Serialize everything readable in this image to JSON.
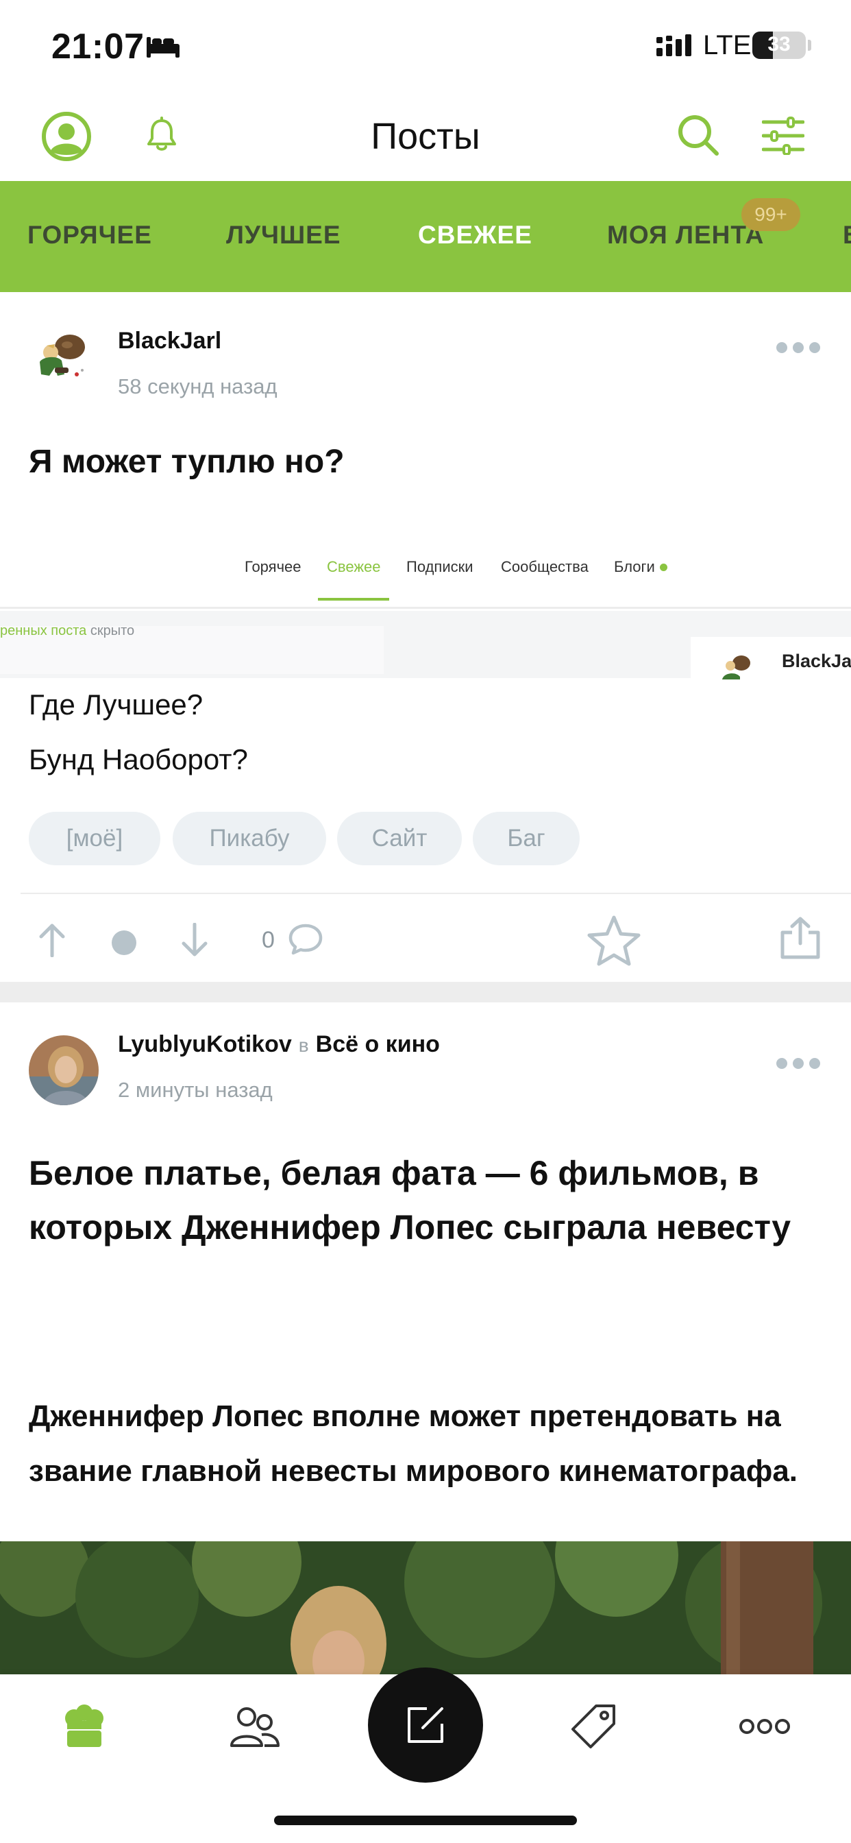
{
  "status_bar": {
    "time": "21:07",
    "network": "LTE",
    "battery": "33"
  },
  "header": {
    "title": "Посты"
  },
  "tabs": {
    "items": [
      "ГОРЯЧЕЕ",
      "ЛУЧШЕЕ",
      "СВЕЖЕЕ",
      "МОЯ ЛЕНТА"
    ],
    "active": "СВЕЖЕЕ",
    "badge": "99+"
  },
  "post1": {
    "author": "BlackJarl",
    "time": "58 секунд назад",
    "title": "Я может туплю но?",
    "screenshot": {
      "tabs": [
        "Горячее",
        "Свежее",
        "Подписки",
        "Сообщества",
        "Блоги"
      ],
      "active_tab": "Свежее",
      "hidden_text_green": "ренных поста",
      "hidden_text": "скрыто",
      "card_author": "BlackJa"
    },
    "body_lines": [
      "Где Лучшее?",
      "Бунд Наоборот?"
    ],
    "tags": [
      "[моё]",
      "Пикабу",
      "Сайт",
      "Баг"
    ],
    "comments": "0"
  },
  "post2": {
    "author": "LyublyuKotikov",
    "in_word": "в",
    "community": "Всё о кино",
    "time": "2 минуты назад",
    "title": "Белое платье, белая фата — 6 фильмов, в которых Дженнифер Лопес сыграла невесту",
    "lead": "Дженнифер Лопес вполне может претендовать на звание главной невесты мирового кинематографа."
  },
  "colors": {
    "brand_green": "#8ac440",
    "badge": "#b79d3c",
    "muted": "#9aa3a8"
  },
  "tabbar": {
    "icons": [
      "home-icon",
      "communities-icon",
      "new-post-icon",
      "tags-icon",
      "more-icon"
    ]
  }
}
